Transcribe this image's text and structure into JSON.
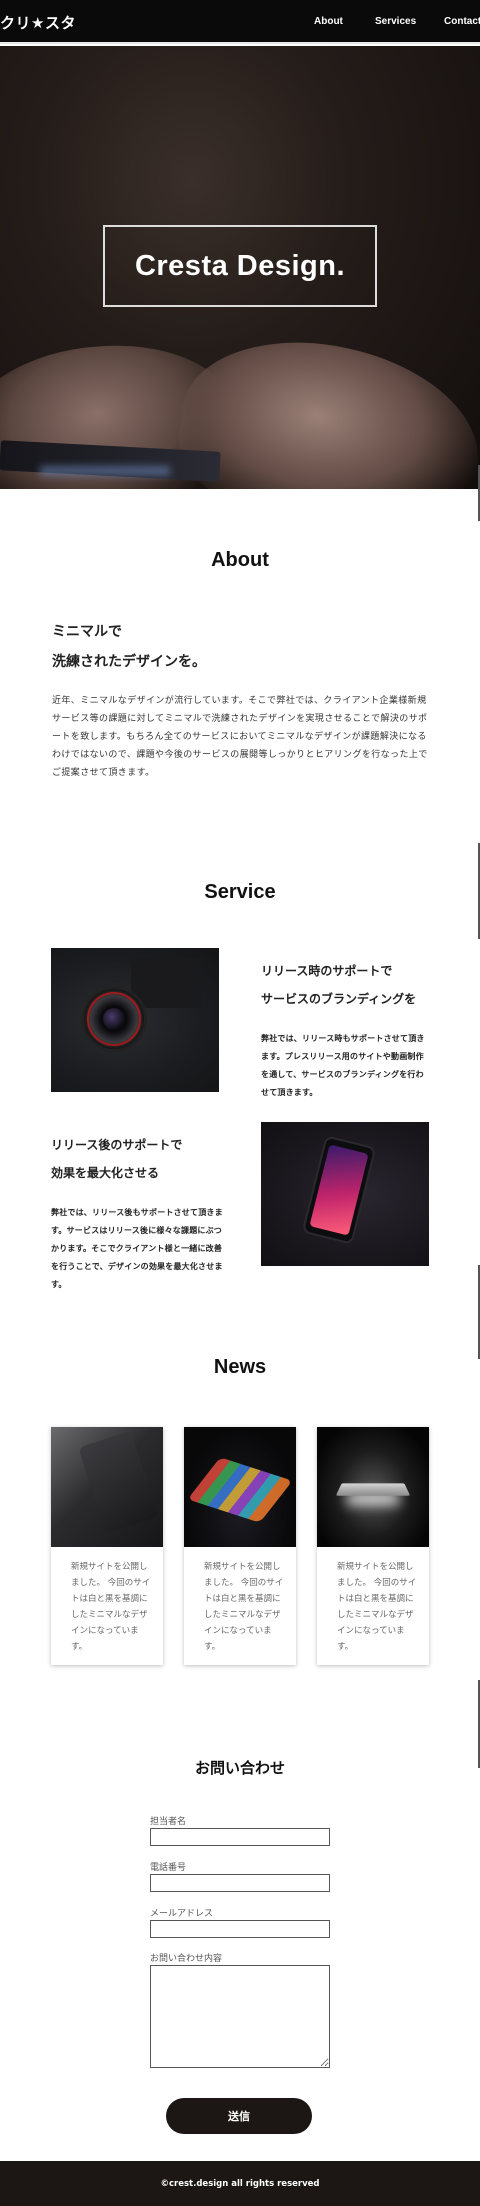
{
  "header": {
    "logo": "クリ★スタ",
    "nav": [
      "About",
      "Services",
      "Contact"
    ]
  },
  "hero": {
    "title": "Cresta Design."
  },
  "about": {
    "title": "About",
    "heading_line1": "ミニマルで",
    "heading_line2": "洗練されたデザインを。",
    "text": "近年、ミニマルなデザインが流行しています。そこで弊社では、クライアント企業様新規サービス等の課題に対してミニマルで洗練されたデザインを実現させることで解決のサポートを致します。もちろん全てのサービスにおいてミニマルなデザインが課題解決になるわけではないので、課題や今後のサービスの展開等しっかりとヒアリングを行なった上でご提案させて頂きます。"
  },
  "service": {
    "title": "Service",
    "items": [
      {
        "heading_line1": "リリース時のサポートで",
        "heading_line2": "サービスのブランディングを",
        "text": "弊社では、リリース時もサポートさせて頂きます。プレスリリース用のサイトや動画制作を通して、サービスのブランディングを行わせて頂きます。",
        "image_icon": "camera-lens-photo"
      },
      {
        "heading_line1": "リリース後のサポートで",
        "heading_line2": "効果を最大化させる",
        "text": "弊社では、リリース後もサポートさせて頂きます。サービスはリリース後に様々な課題にぶつかります。そこでクライアント様と一緒に改善を行うことで、デザインの効果を最大化させます。",
        "image_icon": "smartphone-photo"
      }
    ]
  },
  "news": {
    "title": "News",
    "cards": [
      {
        "text": "新規サイトを公開しました。 今回のサイトは白と黒を基調にしたミニマルなデザインになっています。",
        "image_icon": "phone-on-desk-photo"
      },
      {
        "text": "新規サイトを公開しました。 今回のサイトは白と黒を基調にしたミニマルなデザインになっています。",
        "image_icon": "app-icons-phone-photo"
      },
      {
        "text": "新規サイトを公開しました。 今回のサイトは白と黒を基調にしたミニマルなデザインになっています。",
        "image_icon": "laptop-glow-photo"
      }
    ]
  },
  "contact": {
    "title": "お問い合わせ",
    "fields": [
      {
        "label": "担当者名",
        "value": ""
      },
      {
        "label": "電話番号",
        "value": ""
      },
      {
        "label": "メールアドレス",
        "value": ""
      },
      {
        "label": "お問い合わせ内容",
        "value": ""
      }
    ],
    "submit_label": "送信"
  },
  "footer": {
    "copyright": "©crest.design all rights reserved"
  },
  "colors": {
    "header_bg": "#0a0a0a",
    "dark_brown": "#1c1714",
    "text": "#222222"
  }
}
